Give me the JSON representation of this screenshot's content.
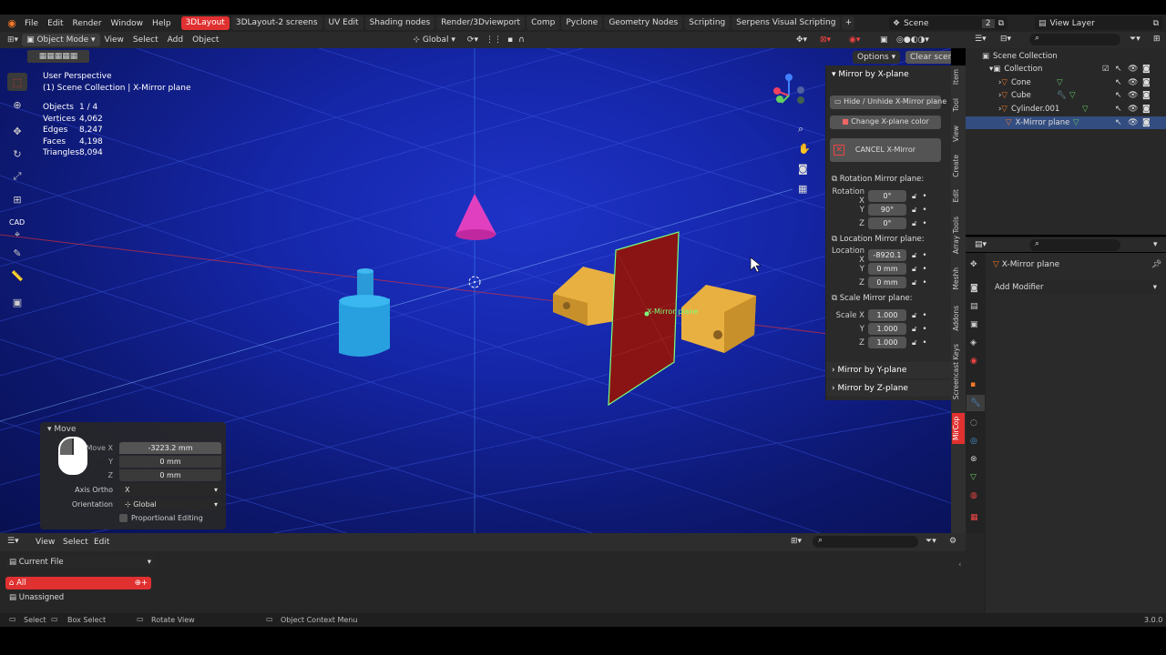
{
  "menubar": {
    "items": [
      "File",
      "Edit",
      "Render",
      "Window",
      "Help"
    ],
    "tabs": [
      "3DLayout",
      "3DLayout-2 screens",
      "UV Edit",
      "Shading nodes",
      "Render/3Dviewport",
      "Comp",
      "Pyclone",
      "Geometry Nodes",
      "Scripting",
      "Serpens Visual Scripting"
    ],
    "active_tab": "3DLayout",
    "scene": "Scene",
    "scene_users": "2",
    "view_layer": "View Layer"
  },
  "header": {
    "mode": "Object Mode",
    "menus": [
      "View",
      "Select",
      "Add",
      "Object"
    ],
    "orientation": "Global",
    "options": "Options",
    "clear_scene": "Clear scene"
  },
  "viewport": {
    "title": "User Perspective",
    "collection": "(1) Scene Collection | X-Mirror plane",
    "stats": [
      {
        "k": "Objects",
        "v": "1 / 4"
      },
      {
        "k": "Vertices",
        "v": "4,062"
      },
      {
        "k": "Edges",
        "v": "8,247"
      },
      {
        "k": "Faces",
        "v": "4,198"
      },
      {
        "k": "Triangles",
        "v": "8,094"
      }
    ],
    "object_label": "X-Mirror plane"
  },
  "tools": {
    "cad_label": "CAD"
  },
  "npanel": {
    "title": "Mirror by X-plane",
    "hide_btn": "Hide / Unhide X-Mirror plane",
    "color_btn": "Change X-plane color",
    "cancel_btn": "CANCEL X-Mirror",
    "rotation_title": "Rotation Mirror plane:",
    "rotation": {
      "label": "Rotation X",
      "x": "0°",
      "y": "90°",
      "z": "0°"
    },
    "location_title": "Location Mirror plane:",
    "location": {
      "label": "Location X",
      "x": "-8920.1",
      "y": "0 mm",
      "z": "0 mm"
    },
    "scale_title": "Scale Mirror plane:",
    "scale": {
      "label": "Scale X",
      "x": "1.000",
      "y": "1.000",
      "z": "1.000"
    },
    "axis_y": "Y",
    "axis_z": "Z",
    "mirror_y": "Mirror by Y-plane",
    "mirror_z": "Mirror by Z-plane"
  },
  "sidetabs": [
    "Item",
    "Tool",
    "View",
    "Create",
    "Edit",
    "Array Tools",
    "Meshh",
    "Addons",
    "Screencast Keys",
    "MirCop"
  ],
  "move": {
    "title": "Move",
    "move_x_label": "Move X",
    "move_x": "-3223.2 mm",
    "y_label": "Y",
    "y": "0 mm",
    "z_label": "Z",
    "z": "0 mm",
    "axis_ortho_label": "Axis Ortho",
    "axis_ortho": "X",
    "orientation_label": "Orientation",
    "orientation": "Global",
    "proportional": "Proportional Editing"
  },
  "outliner": {
    "scene_collection": "Scene Collection",
    "collection": "Collection",
    "items": [
      "Cone",
      "Cube",
      "Cylinder.001",
      "X-Mirror plane"
    ]
  },
  "properties": {
    "object": "X-Mirror plane",
    "add_modifier": "Add Modifier"
  },
  "timeline": {
    "menus": [
      "View",
      "Select",
      "Edit"
    ],
    "dropdown": "Current File",
    "all": "All",
    "unassigned": "Unassigned"
  },
  "statusbar": {
    "select": "Select",
    "box_select": "Box Select",
    "rotate_view": "Rotate View",
    "context_menu": "Object Context Menu",
    "version": "3.0.0"
  },
  "colors": {
    "accent": "#e03030",
    "selection": "#4772b3"
  }
}
